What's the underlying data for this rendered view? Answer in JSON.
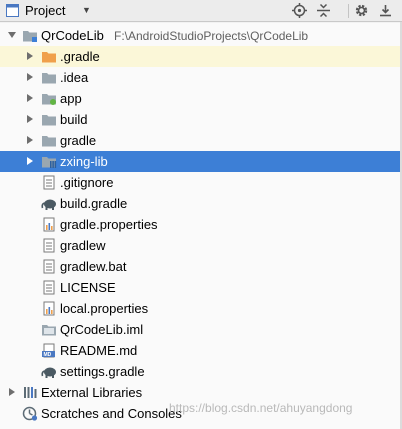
{
  "panel": {
    "title": "Project",
    "toolbar_icons": [
      "locate-icon",
      "collapse-icon",
      "gear-icon",
      "hide-icon"
    ]
  },
  "tree": {
    "root": {
      "label": "QrCodeLib",
      "path": "F:\\AndroidStudioProjects\\QrCodeLib"
    },
    "items": [
      {
        "label": ".gradle",
        "icon": "folder-orange-icon"
      },
      {
        "label": ".idea",
        "icon": "folder-icon"
      },
      {
        "label": "app",
        "icon": "module-folder-icon"
      },
      {
        "label": "build",
        "icon": "folder-icon"
      },
      {
        "label": "gradle",
        "icon": "folder-icon"
      },
      {
        "label": "zxing-lib",
        "icon": "library-module-icon"
      },
      {
        "label": ".gitignore",
        "icon": "text-file-icon"
      },
      {
        "label": "build.gradle",
        "icon": "gradle-elephant-icon"
      },
      {
        "label": "gradle.properties",
        "icon": "properties-file-icon"
      },
      {
        "label": "gradlew",
        "icon": "text-file-icon"
      },
      {
        "label": "gradlew.bat",
        "icon": "text-file-icon"
      },
      {
        "label": "LICENSE",
        "icon": "text-file-icon"
      },
      {
        "label": "local.properties",
        "icon": "properties-file-icon"
      },
      {
        "label": "QrCodeLib.iml",
        "icon": "iml-file-icon"
      },
      {
        "label": "README.md",
        "icon": "markdown-file-icon"
      },
      {
        "label": "settings.gradle",
        "icon": "gradle-elephant-icon"
      }
    ],
    "external_libraries": "External Libraries",
    "scratches": "Scratches and Consoles"
  },
  "watermark": "https://blog.csdn.net/ahuyangdong",
  "colors": {
    "selection": "#3d7fd6",
    "excluded_row": "#fbf7d8",
    "folder": "#9aa7b0",
    "excluded_folder": "#f0a04b"
  }
}
